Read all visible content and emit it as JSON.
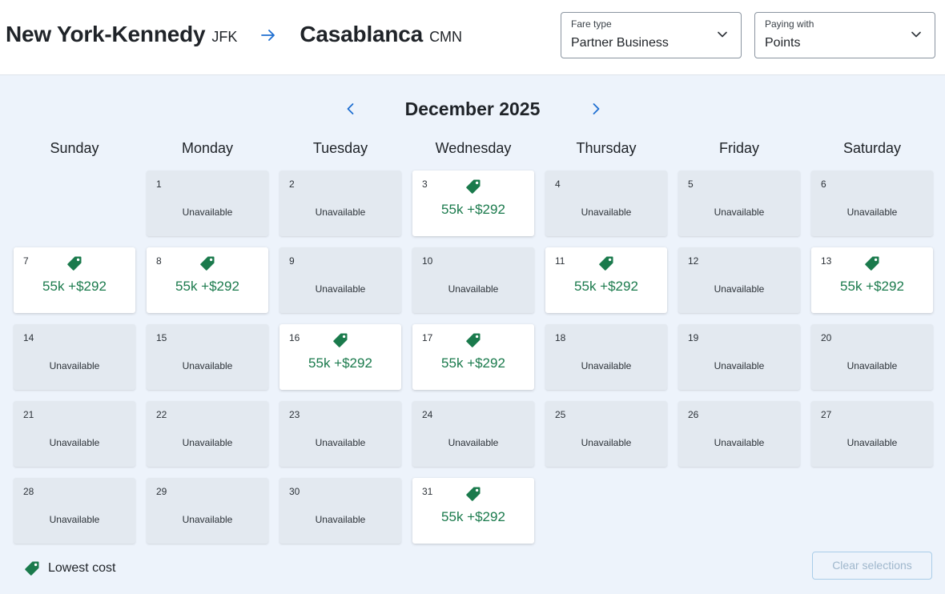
{
  "header": {
    "origin_city": "New York-Kennedy",
    "origin_code": "JFK",
    "destination_city": "Casablanca",
    "destination_code": "CMN",
    "fare_type": {
      "label": "Fare type",
      "value": "Partner Business"
    },
    "paying_with": {
      "label": "Paying with",
      "value": "Points"
    }
  },
  "calendar": {
    "month_title": "December 2025",
    "weekdays": [
      "Sunday",
      "Monday",
      "Tuesday",
      "Wednesday",
      "Thursday",
      "Friday",
      "Saturday"
    ],
    "start_weekday": 1,
    "unavailable_label": "Unavailable",
    "days": [
      {
        "day": "1",
        "available": false
      },
      {
        "day": "2",
        "available": false
      },
      {
        "day": "3",
        "available": true,
        "price": "55k +$292"
      },
      {
        "day": "4",
        "available": false
      },
      {
        "day": "5",
        "available": false
      },
      {
        "day": "6",
        "available": false
      },
      {
        "day": "7",
        "available": true,
        "price": "55k +$292"
      },
      {
        "day": "8",
        "available": true,
        "price": "55k +$292"
      },
      {
        "day": "9",
        "available": false
      },
      {
        "day": "10",
        "available": false
      },
      {
        "day": "11",
        "available": true,
        "price": "55k +$292"
      },
      {
        "day": "12",
        "available": false
      },
      {
        "day": "13",
        "available": true,
        "price": "55k +$292"
      },
      {
        "day": "14",
        "available": false
      },
      {
        "day": "15",
        "available": false
      },
      {
        "day": "16",
        "available": true,
        "price": "55k +$292"
      },
      {
        "day": "17",
        "available": true,
        "price": "55k +$292"
      },
      {
        "day": "18",
        "available": false
      },
      {
        "day": "19",
        "available": false
      },
      {
        "day": "20",
        "available": false
      },
      {
        "day": "21",
        "available": false
      },
      {
        "day": "22",
        "available": false
      },
      {
        "day": "23",
        "available": false
      },
      {
        "day": "24",
        "available": false
      },
      {
        "day": "25",
        "available": false
      },
      {
        "day": "26",
        "available": false
      },
      {
        "day": "27",
        "available": false
      },
      {
        "day": "28",
        "available": false
      },
      {
        "day": "29",
        "available": false
      },
      {
        "day": "30",
        "available": false
      },
      {
        "day": "31",
        "available": true,
        "price": "55k +$292"
      }
    ]
  },
  "legend": {
    "label": "Lowest cost",
    "icon": "price-tag-icon"
  },
  "clear_button": {
    "label": "Clear selections"
  },
  "colors": {
    "price_green": "#1a7a4c",
    "accent_blue": "#1f6fd1",
    "background": "#edf3fb",
    "unavailable_cell": "#e3e9f0"
  }
}
